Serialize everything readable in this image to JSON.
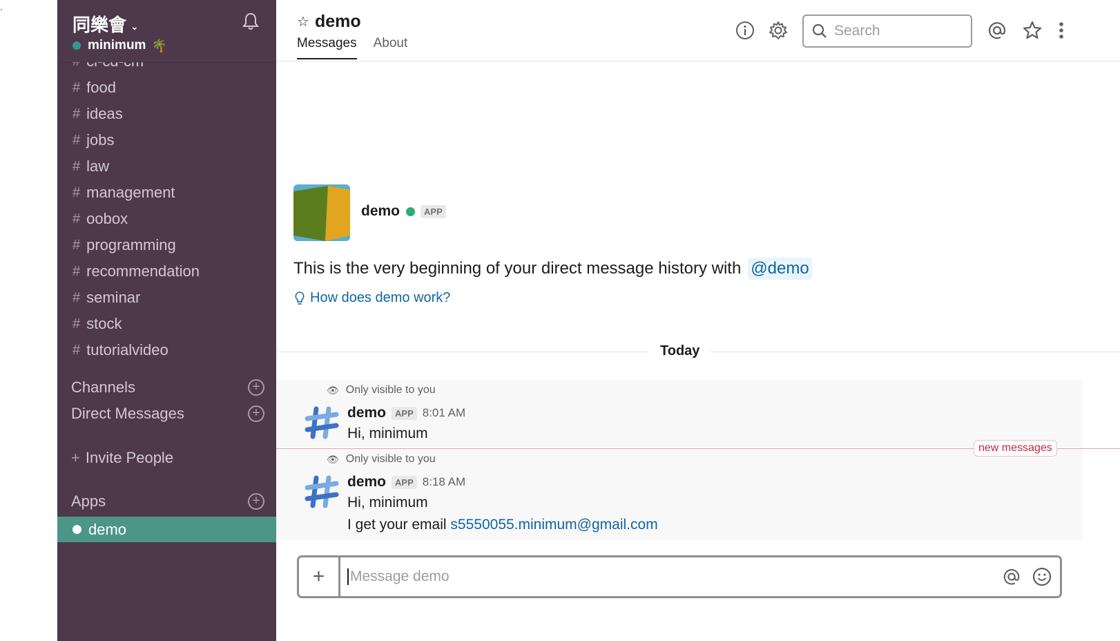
{
  "team": {
    "name": "同樂會",
    "user": "minimum"
  },
  "sidebar": {
    "partial_channel": "ci-cd-cm",
    "channels": [
      "food",
      "ideas",
      "jobs",
      "law",
      "management",
      "oobox",
      "programming",
      "recommendation",
      "seminar",
      "stock",
      "tutorialvideo"
    ],
    "sections": {
      "channels": "Channels",
      "direct_messages": "Direct Messages",
      "apps": "Apps"
    },
    "invite": "Invite People",
    "active_app": "demo"
  },
  "header": {
    "title": "demo",
    "tabs": [
      "Messages",
      "About"
    ],
    "search_placeholder": "Search"
  },
  "intro": {
    "name": "demo",
    "badge": "APP",
    "text": "This is the very beginning of your direct message history with",
    "mention": "@demo",
    "help_link": "How does demo work?"
  },
  "divider": {
    "label": "Today",
    "new_messages": "new messages"
  },
  "messages": [
    {
      "visibility": "Only visible to you",
      "author": "demo",
      "badge": "APP",
      "time": "8:01 AM",
      "lines": [
        "Hi, minimum"
      ]
    },
    {
      "visibility": "Only visible to you",
      "author": "demo",
      "badge": "APP",
      "time": "8:18 AM",
      "lines": [
        "Hi, minimum",
        "I get your email"
      ],
      "email": "s5550055.minimum@gmail.com"
    }
  ],
  "composer": {
    "placeholder": "Message demo"
  },
  "colors": {
    "sidebar": "#4d394b",
    "active": "#4c9689",
    "link": "#1264a3",
    "online": "#2bac76"
  }
}
